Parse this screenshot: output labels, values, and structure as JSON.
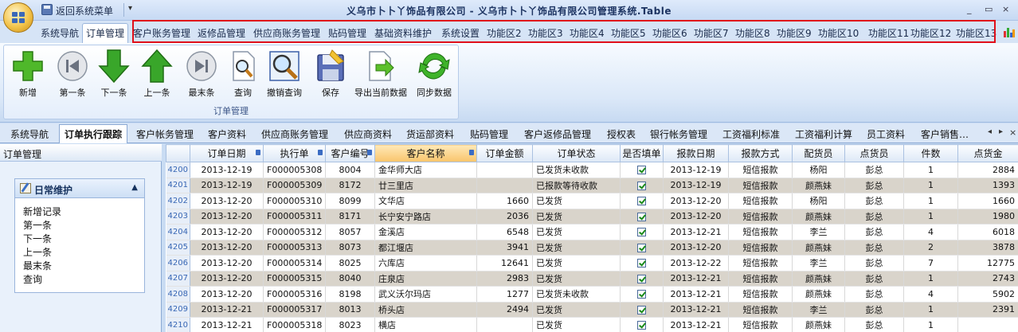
{
  "title": "义乌市卜卜丫饰品有限公司 - 义乌市卜卜丫饰品有限公司管理系统.Table",
  "quick_access": {
    "return_label": "返回系统菜单",
    "dropdown": "▾"
  },
  "window_controls": {
    "minimize": "_",
    "restore": "▭",
    "close": "×"
  },
  "menu": {
    "items": [
      "系统导航",
      "订单管理",
      "客户账务管理",
      "返修品管理",
      "供应商账务管理",
      "贴码管理",
      "基础资料维护",
      "系统设置",
      "功能区2",
      "功能区3",
      "功能区4",
      "功能区5",
      "功能区6",
      "功能区7",
      "功能区8",
      "功能区9",
      "功能区10",
      "功能区11",
      "功能区12",
      "功能区13"
    ],
    "active_index": 1
  },
  "ribbon": {
    "group_label": "订单管理",
    "buttons": [
      "新增",
      "第一条",
      "下一条",
      "上一条",
      "最末条",
      "查询",
      "撤销查询",
      "保存",
      "导出当前数据",
      "同步数据"
    ]
  },
  "tabs": {
    "items": [
      "系统导航",
      "订单执行跟踪",
      "客户帐务管理",
      "客户资料",
      "供应商账务管理",
      "供应商资料",
      "货运部资料",
      "贴码管理",
      "客户返修品管理",
      "授权表",
      "银行帐务管理",
      "工资福利标准",
      "工资福利计算",
      "员工资料",
      "客户销售…"
    ],
    "active_index": 1,
    "nav_prev": "◂",
    "nav_next": "▸",
    "nav_close": "×"
  },
  "left_panel": {
    "title": "订单管理",
    "box_title": "日常维护",
    "collapse_arrow": "▲",
    "items": [
      "新增记录",
      "第一条",
      "下一条",
      "上一条",
      "最末条",
      "查询"
    ]
  },
  "grid": {
    "columns": [
      "订单日期",
      "执行单",
      "客户编号",
      "客户名称",
      "订单金额",
      "订单状态",
      "是否填单",
      "报款日期",
      "报款方式",
      "配货员",
      "点货员",
      "件数",
      "点货金"
    ],
    "rows": [
      {
        "n": "4200",
        "date": "2013-12-19",
        "order": "F000005308",
        "code": "8004",
        "name": "金华师大店",
        "amount": "",
        "status": "已发货未收款",
        "filled": true,
        "pay_date": "2013-12-19",
        "pay_method": "短信报款",
        "picker": "杨阳",
        "checker": "彭总",
        "qty": "1",
        "check_amt": "2884"
      },
      {
        "n": "4201",
        "date": "2013-12-19",
        "order": "F000005309",
        "code": "8172",
        "name": "廿三里店",
        "amount": "",
        "status": "已报款等待收款",
        "filled": true,
        "pay_date": "2013-12-19",
        "pay_method": "短信报款",
        "picker": "颜燕妹",
        "checker": "彭总",
        "qty": "1",
        "check_amt": "1393"
      },
      {
        "n": "4202",
        "date": "2013-12-20",
        "order": "F000005310",
        "code": "8099",
        "name": "文华店",
        "amount": "1660",
        "status": "已发货",
        "filled": true,
        "pay_date": "2013-12-20",
        "pay_method": "短信报款",
        "picker": "杨阳",
        "checker": "彭总",
        "qty": "1",
        "check_amt": "1660"
      },
      {
        "n": "4203",
        "date": "2013-12-20",
        "order": "F000005311",
        "code": "8171",
        "name": "长宁安宁路店",
        "amount": "2036",
        "status": "已发货",
        "filled": true,
        "pay_date": "2013-12-20",
        "pay_method": "短信报款",
        "picker": "颜燕妹",
        "checker": "彭总",
        "qty": "1",
        "check_amt": "1980"
      },
      {
        "n": "4204",
        "date": "2013-12-20",
        "order": "F000005312",
        "code": "8057",
        "name": "金溪店",
        "amount": "6548",
        "status": "已发货",
        "filled": true,
        "pay_date": "2013-12-21",
        "pay_method": "短信报款",
        "picker": "李兰",
        "checker": "彭总",
        "qty": "4",
        "check_amt": "6018"
      },
      {
        "n": "4205",
        "date": "2013-12-20",
        "order": "F000005313",
        "code": "8073",
        "name": "都江堰店",
        "amount": "3941",
        "status": "已发货",
        "filled": true,
        "pay_date": "2013-12-20",
        "pay_method": "短信报款",
        "picker": "颜燕妹",
        "checker": "彭总",
        "qty": "2",
        "check_amt": "3878"
      },
      {
        "n": "4206",
        "date": "2013-12-20",
        "order": "F000005314",
        "code": "8025",
        "name": "六库店",
        "amount": "12641",
        "status": "已发货",
        "filled": true,
        "pay_date": "2013-12-22",
        "pay_method": "短信报款",
        "picker": "李兰",
        "checker": "彭总",
        "qty": "7",
        "check_amt": "12775"
      },
      {
        "n": "4207",
        "date": "2013-12-20",
        "order": "F000005315",
        "code": "8040",
        "name": "庄泉店",
        "amount": "2983",
        "status": "已发货",
        "filled": true,
        "pay_date": "2013-12-21",
        "pay_method": "短信报款",
        "picker": "颜燕妹",
        "checker": "彭总",
        "qty": "1",
        "check_amt": "2743"
      },
      {
        "n": "4208",
        "date": "2013-12-20",
        "order": "F000005316",
        "code": "8198",
        "name": "武义沃尔玛店",
        "amount": "1277",
        "status": "已发货未收款",
        "filled": true,
        "pay_date": "2013-12-21",
        "pay_method": "短信报款",
        "picker": "颜燕妹",
        "checker": "彭总",
        "qty": "4",
        "check_amt": "5902"
      },
      {
        "n": "4209",
        "date": "2013-12-21",
        "order": "F000005317",
        "code": "8013",
        "name": "桥头店",
        "amount": "2494",
        "status": "已发货",
        "filled": true,
        "pay_date": "2013-12-21",
        "pay_method": "短信报款",
        "picker": "李兰",
        "checker": "彭总",
        "qty": "1",
        "check_amt": "2391"
      },
      {
        "n": "4210",
        "date": "2013-12-21",
        "order": "F000005318",
        "code": "8023",
        "name": "横店",
        "amount": "",
        "status": "已发货",
        "filled": true,
        "pay_date": "2013-12-21",
        "pay_method": "短信报款",
        "picker": "颜燕妹",
        "checker": "彭总",
        "qty": "1",
        "check_amt": ""
      }
    ]
  },
  "colors": {
    "highlight_border": "#e0101a",
    "ribbon_bg": "#dbe8f8",
    "alt_row": "#d9d4cb",
    "header_highlight": "#f9c46b"
  }
}
